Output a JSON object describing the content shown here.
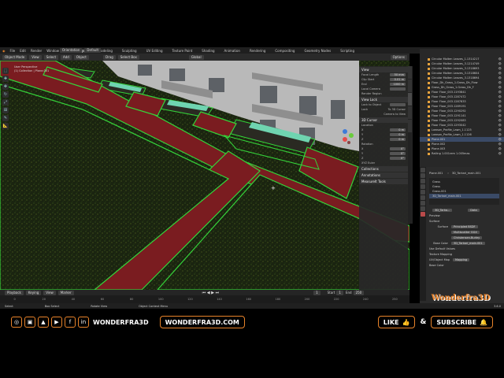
{
  "menu": [
    "File",
    "Edit",
    "Render",
    "Window",
    "Help"
  ],
  "workspaces": [
    "Layout",
    "Modeling",
    "Sculpting",
    "UV Editing",
    "Texture Paint",
    "Shading",
    "Animation",
    "Rendering",
    "Compositing",
    "Geometry Nodes",
    "Scripting"
  ],
  "active_workspace": "Layout",
  "scene": "Scene",
  "view_layer": "View Layer",
  "header": {
    "mode": "Object Mode",
    "view": "View",
    "select": "Select",
    "add": "Add",
    "object": "Object",
    "orientation": "Orientation",
    "default": "Default",
    "drag": "Drag",
    "select_box": "Select Box",
    "global": "Global",
    "options": "Options"
  },
  "viewport_text": {
    "view_name": "User Perspective",
    "collection": "(1) Collection | Plane.001"
  },
  "npanel": {
    "view_title": "View",
    "focal_length_label": "Focal Length",
    "focal_length": "50 mm",
    "clip_start_label": "Clip Start",
    "clip_start": "0.01 m",
    "end_label": "End",
    "end": "1000 m",
    "local_camera_label": "Local Camera",
    "render_region": "Render Region",
    "view_lock_title": "View Lock",
    "lock_object_label": "Lock to Object",
    "lock_label": "Lock",
    "to_3d_cursor": "To 3D Cursor",
    "camera_to_view": "Camera to View",
    "cursor_title": "3D Cursor",
    "location_label": "Location",
    "x_label": "X",
    "y_label": "Y",
    "z_label": "Z",
    "loc_value": "0 m",
    "rotation_label": "Rotation",
    "rot_value": "0°",
    "xyz_euler": "XYZ Euler",
    "collections": "Collections",
    "annotations": "Annotations",
    "measureit": "MeasureIt Tools"
  },
  "outliner": [
    {
      "name": "Circular Molten Leaves_1.1314217",
      "sel": false
    },
    {
      "name": "Circular Molten Leaves_3.1214749",
      "sel": false
    },
    {
      "name": "Circular Molten Leaves_3.1318693",
      "sel": false
    },
    {
      "name": "Circular Molten Leaves_3.1318604",
      "sel": false
    },
    {
      "name": "Circular Molten Leaves_3.1318694",
      "sel": false
    },
    {
      "name": "Floor_Dh_Grass_1.Grass_Dh_Flow",
      "sel": false
    },
    {
      "name": "Grass_Dh_Grass_1.Grass_Dh_F",
      "sel": false
    },
    {
      "name": "Floor Floor_003.1193841",
      "sel": false
    },
    {
      "name": "Floor Floor_003.1287472",
      "sel": false
    },
    {
      "name": "Floor Floor_003.1287833",
      "sel": false
    },
    {
      "name": "Floor Floor_003.1289191",
      "sel": false
    },
    {
      "name": "Floor Floor_003.1290292",
      "sel": false
    },
    {
      "name": "Floor Floor_003.1291141",
      "sel": false
    },
    {
      "name": "Floor Floor_003.1292083",
      "sel": false
    },
    {
      "name": "Floor Floor_003.1293042",
      "sel": false
    },
    {
      "name": "Lawson_Profile_Lawn_1.1125",
      "sel": false
    },
    {
      "name": "Lawson_Profile_Lawn_1.1126",
      "sel": false
    },
    {
      "name": "Plane.001",
      "sel": true
    },
    {
      "name": "Plane.002",
      "sel": false
    },
    {
      "name": "Plane.003",
      "sel": false
    },
    {
      "name": "Railing 1.001rem 1.005mas",
      "sel": false
    }
  ],
  "properties": {
    "object_name": "Plane.001",
    "material_name": "3D_Tarkari_main.001",
    "slots": [
      "Grass",
      "Grass",
      "Grass.001",
      "3D_Tarkari_main.001"
    ],
    "mat_tab": "3D_Tarka...",
    "data_tab": "Data",
    "preview": "Preview",
    "surface_title": "Surface",
    "surface_label": "Surface",
    "surface_value": "Principled BSDF",
    "multiscatter": "Multiscatter GGX",
    "christensen": "Christensen-Burley",
    "base_color_label": "Base Color",
    "base_color_value": "3D_Tarkari_main.001",
    "use_default": "Use Default Values",
    "texture_mapping": "Texture Mapping",
    "uv_object": "UV/Object Map",
    "mapping": "Mapping",
    "base_color2": "Base Color"
  },
  "timeline": {
    "playback": "Playback",
    "keying": "Keying",
    "view": "View",
    "marker": "Marker",
    "current_frame": "1",
    "start_label": "Start",
    "start": "1",
    "end_label": "End",
    "end": "250",
    "ticks": [
      "0",
      "20",
      "40",
      "60",
      "80",
      "100",
      "120",
      "140",
      "160",
      "180",
      "200",
      "220",
      "240",
      "250"
    ]
  },
  "statusbar": {
    "select": "Select",
    "box_select": "Box Select",
    "rotate": "Rotate View",
    "menu": "Object Context Menu",
    "version": "3.6.0"
  },
  "banner": {
    "icons": [
      "instagram-icon",
      "twitch-icon",
      "artstation-icon",
      "youtube-icon",
      "facebook-icon",
      "linkedin-icon"
    ],
    "glyphs": [
      "◎",
      "▣",
      "▲",
      "▶",
      "f",
      "in"
    ],
    "handle": "WONDERFRA3D",
    "website": "WONDERFRA3D.COM",
    "like": "LIKE",
    "amp": "&",
    "subscribe": "SUBSCRIBE",
    "accent": "#e8832a"
  },
  "watermark": "Wonderfra3D",
  "colors": {
    "path": "#7a1c20",
    "grass": "#1e2a12",
    "outline": "#35d43a"
  }
}
